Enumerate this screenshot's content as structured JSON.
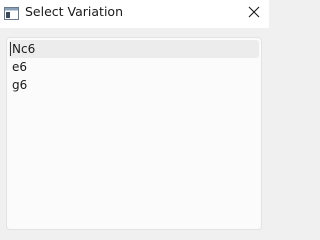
{
  "window": {
    "title": "Select Variation"
  },
  "variations": [
    {
      "label": "Nc6",
      "selected": true
    },
    {
      "label": "e6",
      "selected": false
    },
    {
      "label": "g6",
      "selected": false
    }
  ],
  "icons": {
    "app": "window-app-icon",
    "close": "close-icon"
  }
}
